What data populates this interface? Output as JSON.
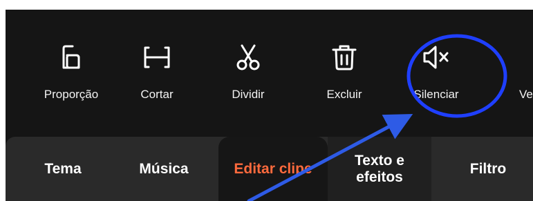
{
  "toolbar": {
    "tools": [
      {
        "label": "Proporção",
        "icon": "aspect-ratio-icon"
      },
      {
        "label": "Cortar",
        "icon": "crop-brackets-icon"
      },
      {
        "label": "Dividir",
        "icon": "scissors-icon"
      },
      {
        "label": "Excluir",
        "icon": "trash-icon"
      },
      {
        "label": "Silenciar",
        "icon": "mute-speaker-icon"
      },
      {
        "label": "Ve"
      }
    ]
  },
  "tabs": [
    {
      "label": "Tema"
    },
    {
      "label": "Música"
    },
    {
      "label": "Editar clipe",
      "active": true
    },
    {
      "label": "Texto e efeitos"
    },
    {
      "label": "Filtro"
    }
  ],
  "colors": {
    "panel_bg": "#151515",
    "tabbar_bg": "#2a2a2a",
    "active_tab_text": "#ff6a3d",
    "annotation_blue": "#1f3fff",
    "arrow_blue": "#2e5be6"
  },
  "annotations": [
    {
      "type": "ellipse",
      "target": "tool-silenciar"
    },
    {
      "type": "arrow",
      "target": "tool-silenciar"
    }
  ]
}
